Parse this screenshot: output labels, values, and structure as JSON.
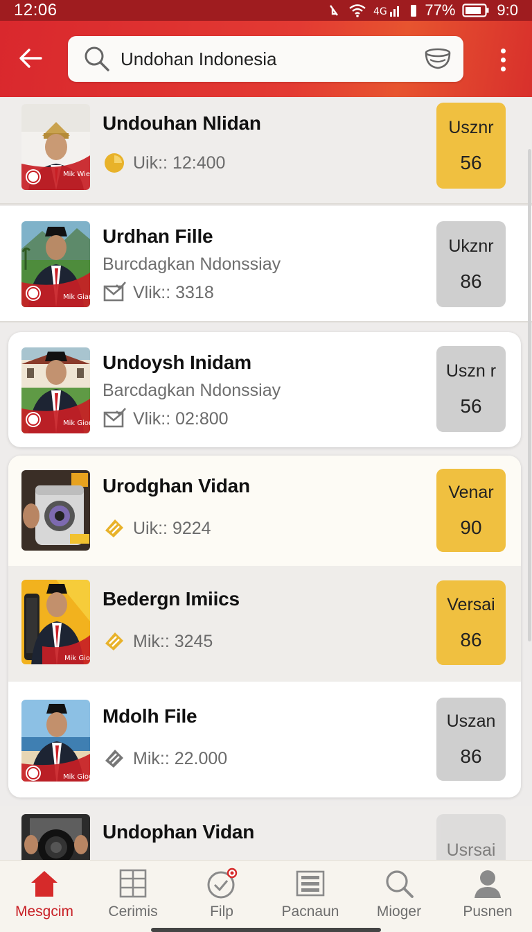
{
  "status_bar": {
    "time": "12:06",
    "battery_percent": "77%",
    "clock_right": "9:0"
  },
  "search": {
    "value": "Undohan Indonesia",
    "placeholder": ""
  },
  "rows": [
    {
      "title": "Undouhan Nlidan",
      "subtitle": "",
      "stat": "Uik:: 12:400",
      "stat_icon": "coin-icon",
      "badge_label": "Usznr",
      "badge_value": "56",
      "badge_color": "#f0c040",
      "thumb_caption": "Mik Wiex"
    },
    {
      "title": "Urdhan Fille",
      "subtitle": "Burcdagkan Ndonssiay",
      "stat": "Vlik:: 3318",
      "stat_icon": "mail-check-icon",
      "badge_label": "Ukznr",
      "badge_value": "86",
      "badge_color": "#cfcfcf",
      "thumb_caption": "Mik Gians"
    },
    {
      "title": "Undoysh Inidam",
      "subtitle": "Barcdagkan Ndonssiay",
      "stat": "Vlik:: 02:800",
      "stat_icon": "mail-check-icon",
      "badge_label": "Uszn r",
      "badge_value": "56",
      "badge_color": "#cfcfcf",
      "thumb_caption": "Mik Gions"
    },
    {
      "title": "Urodghan Vidan",
      "subtitle": "",
      "stat": "Uik:: 9224",
      "stat_icon": "gold-tag-icon",
      "badge_label": "Venar",
      "badge_value": "90",
      "badge_color": "#f0c040",
      "thumb_caption": ""
    },
    {
      "title": "Bedergn Imiics",
      "subtitle": "",
      "stat": "Mik:: 3245",
      "stat_icon": "gold-tag-icon",
      "badge_label": "Versai",
      "badge_value": "86",
      "badge_color": "#f0c040",
      "thumb_caption": "Mik Gions"
    },
    {
      "title": "Mdolh File",
      "subtitle": "",
      "stat": "Mik:: 22.000",
      "stat_icon": "gray-tag-icon",
      "badge_label": "Uszan",
      "badge_value": "86",
      "badge_color": "#cfcfcf",
      "thumb_caption": "Mik Gious"
    },
    {
      "title": "Undophan Vidan",
      "subtitle": "",
      "stat": "",
      "stat_icon": "mail-check-icon",
      "badge_label": "Usrsai",
      "badge_value": "",
      "badge_color": "#cfcfcf",
      "thumb_caption": ""
    }
  ],
  "bottom_nav": [
    {
      "label": "Mesgcim",
      "icon": "home-icon",
      "active": true
    },
    {
      "label": "Cerimis",
      "icon": "grid-icon",
      "active": false
    },
    {
      "label": "Filp",
      "icon": "clock-check-icon",
      "active": false
    },
    {
      "label": "Pacnaun",
      "icon": "list-icon",
      "active": false
    },
    {
      "label": "Mioger",
      "icon": "search-icon",
      "active": false
    },
    {
      "label": "Pusnen",
      "icon": "person-icon",
      "active": false
    }
  ],
  "colors": {
    "header_red": "#d9282d",
    "status_red": "#9f1c1f",
    "badge_yellow": "#f0c040",
    "badge_gray": "#cfcfcf",
    "active_nav": "#c81f25"
  }
}
